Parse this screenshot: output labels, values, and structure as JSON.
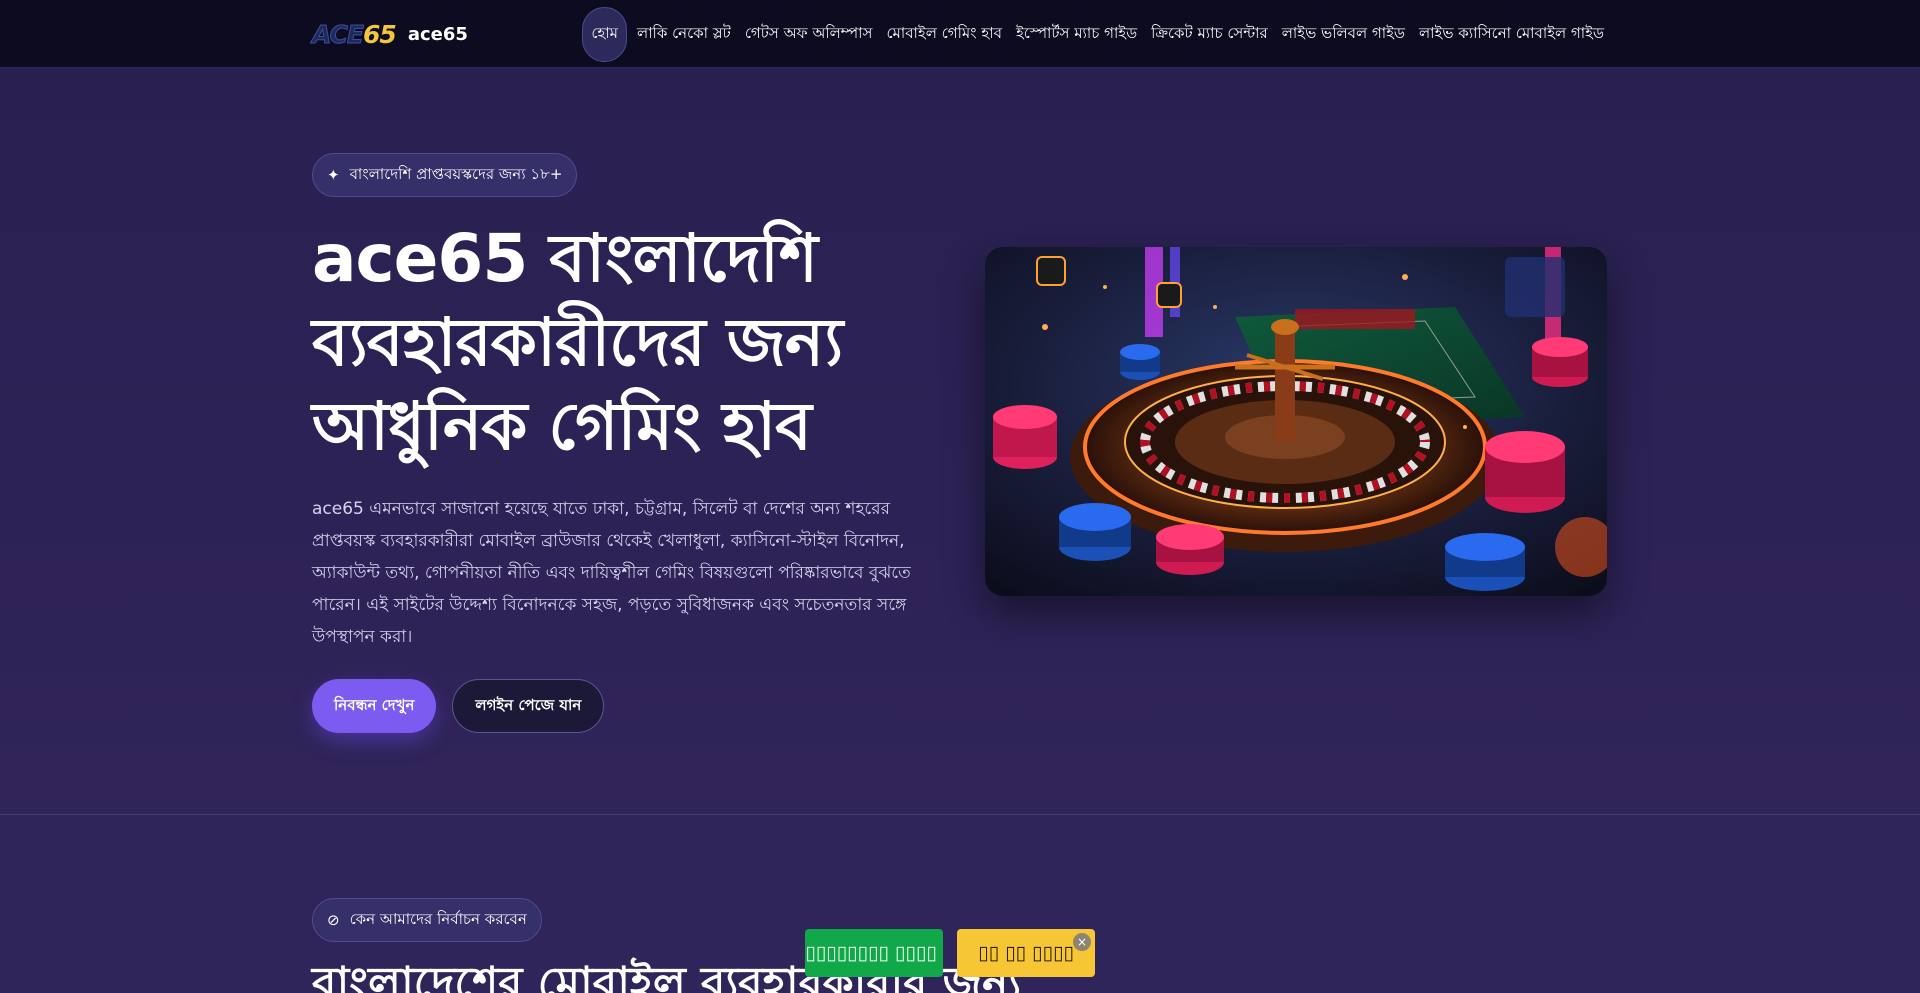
{
  "header": {
    "logo": {
      "ace": "ACE",
      "num": "65"
    },
    "brand_name": "ace65",
    "nav": [
      {
        "label": "হোম",
        "active": true
      },
      {
        "label": "লাকি নেকো স্লট",
        "active": false
      },
      {
        "label": "গেটস অফ অলিম্পাস",
        "active": false
      },
      {
        "label": "মোবাইল গেমিং হাব",
        "active": false
      },
      {
        "label": "ইস্পোর্টস ম্যাচ গাইড",
        "active": false
      },
      {
        "label": "ক্রিকেট ম্যাচ সেন্টার",
        "active": false
      },
      {
        "label": "লাইভ ভলিবল গাইড",
        "active": false
      },
      {
        "label": "লাইভ ক্যাসিনো মোবাইল গাইড",
        "active": false
      }
    ]
  },
  "hero": {
    "badge": "বাংলাদেশি প্রাপ্তবয়স্কদের জন্য ১৮+",
    "title_lines": [
      "ace65 বাংলাদেশি",
      "ব্যবহারকারীদের জন্য",
      "আধুনিক গেমিং হাব"
    ],
    "description": "ace65 এমনভাবে সাজানো হয়েছে যাতে ঢাকা, চট্টগ্রাম, সিলেট বা দেশের অন্য শহরের প্রাপ্তবয়স্ক ব্যবহারকারীরা মোবাইল ব্রাউজার থেকেই খেলাধুলা, ক্যাসিনো-স্টাইল বিনোদন, অ্যাকাউন্ট তথ্য, গোপনীয়তা নীতি এবং দায়িত্বশীল গেমিং বিষয়গুলো পরিষ্কারভাবে বুঝতে পারেন। এই সাইটের উদ্দেশ্য বিনোদনকে সহজ, পড়তে সুবিধাজনক এবং সচেতনতার সঙ্গে উপস্থাপন করা।",
    "primary_button": "নিবন্ধন দেখুন",
    "secondary_button": "লগইন পেজে যান"
  },
  "section2": {
    "badge": "কেন আমাদের নির্বাচন করবেন",
    "title": "বাংলাদেশের মোবাইল ব্যবহারকারীর জন্য"
  },
  "floating": {
    "green_label": "▯▯▯▯▯▯▯▯ ▯▯▯▯",
    "yellow_label": "▯▯ ▯▯ ▯▯▯▯",
    "close": "×"
  },
  "colors": {
    "accent": "#7c5cf0",
    "header_bg": "#0d0b1f",
    "hero_bg": "#2b2152",
    "logo_yellow": "#f5c63a",
    "float_green": "#11a84a",
    "float_yellow": "#f7c634"
  },
  "icons": {
    "badge_icon": "sparkle-icon",
    "section2_icon": "compass-icon",
    "hero_image": "roulette-casino-image"
  }
}
